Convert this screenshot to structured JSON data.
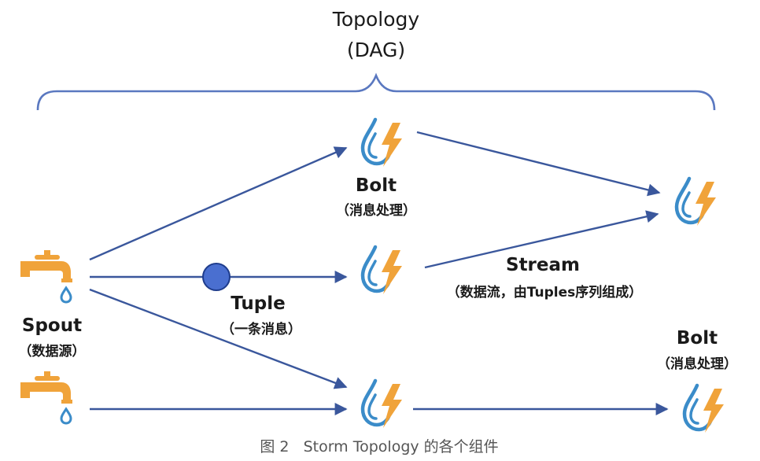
{
  "topology": {
    "title_line1": "Topology",
    "title_line2": "(DAG)"
  },
  "labels": {
    "bolt_top": "Bolt",
    "bolt_top_sub": "（消息处理）",
    "stream": "Stream",
    "stream_sub": "（数据流，由Tuples序列组成）",
    "tuple": "Tuple",
    "tuple_sub": "（一条消息）",
    "spout": "Spout",
    "spout_sub": "（数据源）",
    "bolt_right": "Bolt",
    "bolt_right_sub": "（消息处理）"
  },
  "caption": "图 2   Storm Topology 的各个组件",
  "colors": {
    "edge": "#3a579c",
    "brace": "#5a78c0",
    "drop": "#3b8cc9",
    "bolt": "#f0a33a",
    "faucet": "#f0a33a",
    "tuple_fill": "#4a6fd0",
    "tuple_stroke": "#1e3c8c"
  },
  "icons": {
    "spout": "faucet-icon",
    "bolt": "drop-lightning-icon",
    "tuple": "circle-icon"
  }
}
